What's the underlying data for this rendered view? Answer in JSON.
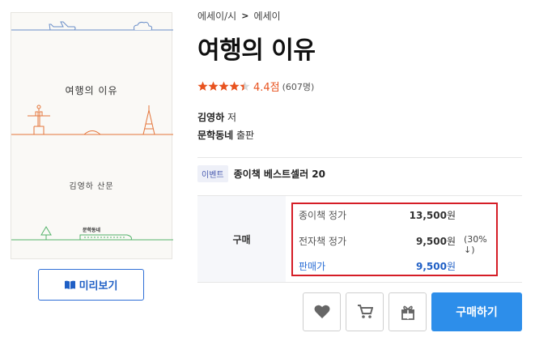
{
  "cover": {
    "title": "여행의 이유",
    "author": "김영하 산문",
    "publisher": "문학동네"
  },
  "preview_button": {
    "label": "미리보기",
    "icon": "open-book-icon"
  },
  "breadcrumb": {
    "parent": "에세이/시",
    "current": "에세이",
    "separator": ">"
  },
  "title": "여행의 이유",
  "rating": {
    "score": "4.4점",
    "count": "(607명)",
    "stars_value": 4.4,
    "stars_max": 5,
    "star_color": "#e8531f"
  },
  "author": {
    "name": "김영하",
    "role": "저"
  },
  "publisher": {
    "name": "문학동네",
    "role": "출판"
  },
  "event": {
    "badge": "이벤트",
    "text": "종이책 베스트셀러 20"
  },
  "purchase": {
    "label": "구매",
    "rows": [
      {
        "label": "종이책 정가",
        "value": "13,500",
        "unit": "원",
        "discount": ""
      },
      {
        "label": "전자책 정가",
        "value": "9,500",
        "unit": "원",
        "discount": "(30% ↓)"
      },
      {
        "label": "판매가",
        "value": "9,500",
        "unit": "원",
        "discount": ""
      }
    ],
    "highlight_color": "#d51d26"
  },
  "actions": {
    "wishlist_icon": "heart-icon",
    "cart_icon": "cart-icon",
    "gift_icon": "gift-icon",
    "buy_label": "구매하기",
    "buy_color": "#2d8eea"
  }
}
